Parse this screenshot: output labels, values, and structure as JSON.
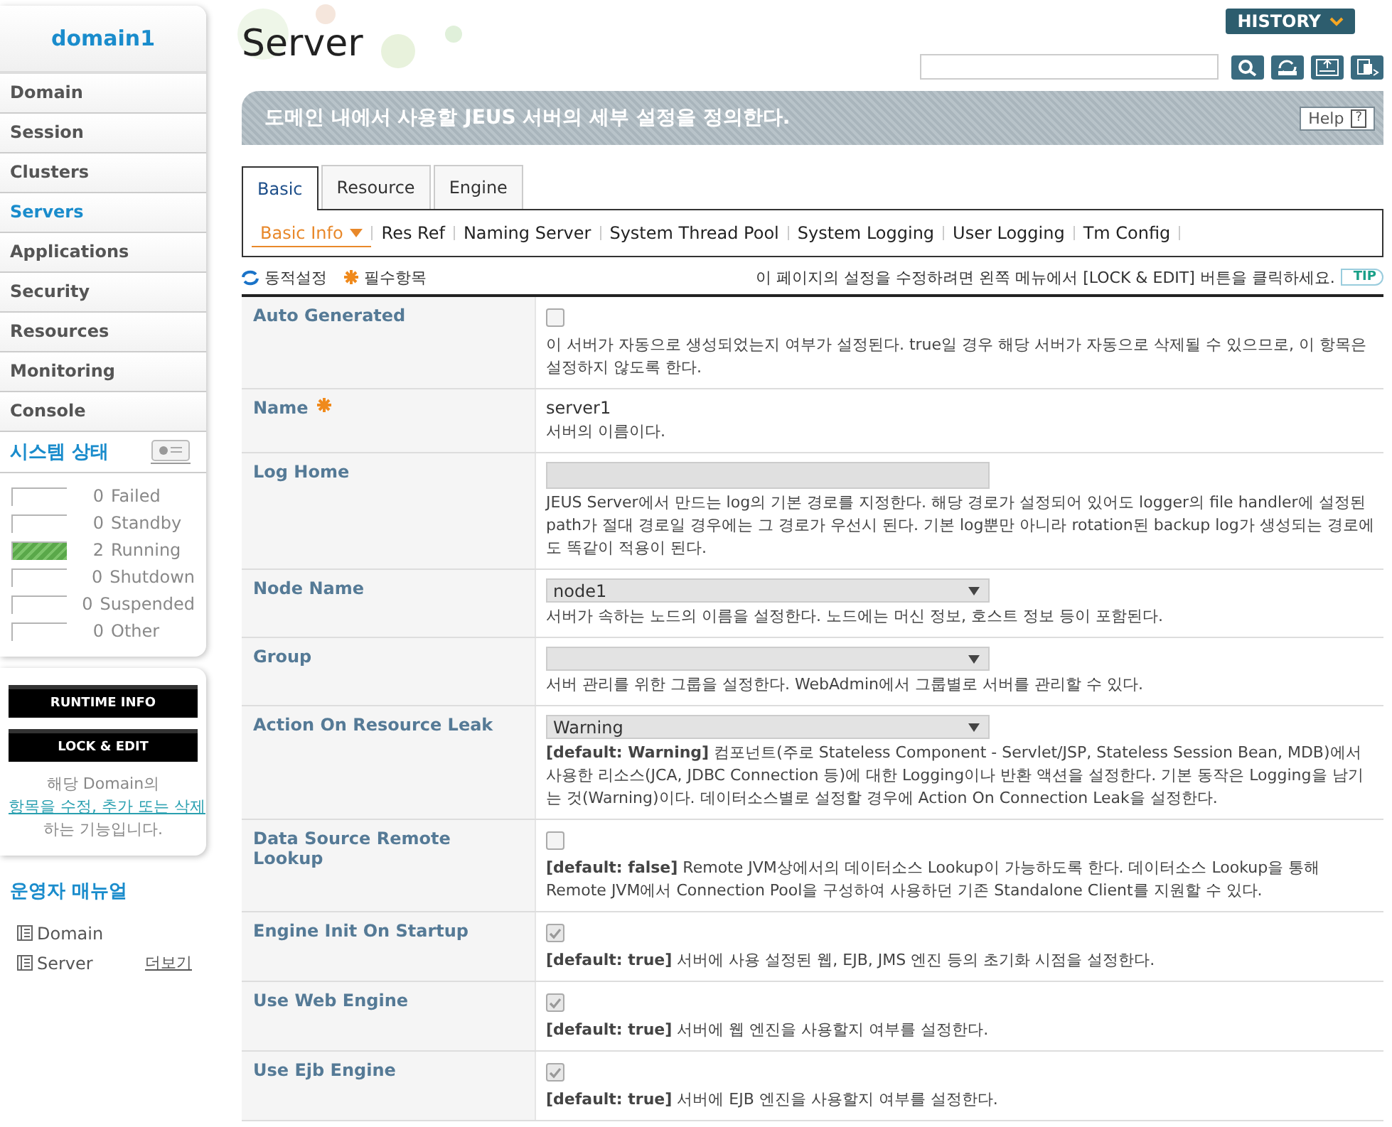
{
  "sidebar": {
    "domain": "domain1",
    "menu": [
      {
        "label": "Domain",
        "selected": false
      },
      {
        "label": "Session",
        "selected": false
      },
      {
        "label": "Clusters",
        "selected": false
      },
      {
        "label": "Servers",
        "selected": true
      },
      {
        "label": "Applications",
        "selected": false
      },
      {
        "label": "Security",
        "selected": false
      },
      {
        "label": "Resources",
        "selected": false
      },
      {
        "label": "Monitoring",
        "selected": false
      },
      {
        "label": "Console",
        "selected": false
      }
    ],
    "status_title": "시스템 상태",
    "status": [
      {
        "count": "0",
        "label": "Failed",
        "level": 0
      },
      {
        "count": "0",
        "label": "Standby",
        "level": 0
      },
      {
        "count": "2",
        "label": "Running",
        "level": 1
      },
      {
        "count": "0",
        "label": "Shutdown",
        "level": 0
      },
      {
        "count": "0",
        "label": "Suspended",
        "level": 0
      },
      {
        "count": "0",
        "label": "Other",
        "level": 0
      }
    ],
    "buttons": [
      "RUNTIME INFO",
      "LOCK & EDIT"
    ],
    "note_before": "해당 Domain의 ",
    "note_link": "항목을 수정, 추가 또는 삭제",
    "note_after": "하는 기능입니다.",
    "manual_title": "운영자 매뉴얼",
    "manual_items": [
      "Domain",
      "Server"
    ],
    "manual_more": "더보기"
  },
  "header": {
    "title": "Server",
    "history": "HISTORY"
  },
  "banner": {
    "text": "도메인 내에서 사용할 JEUS 서버의 세부 설정을 정의한다.",
    "help": "Help",
    "help_icon": "?"
  },
  "tabs": [
    {
      "label": "Basic",
      "selected": true
    },
    {
      "label": "Resource",
      "selected": false
    },
    {
      "label": "Engine",
      "selected": false
    }
  ],
  "subtabs": [
    {
      "label": "Basic Info",
      "selected": true
    },
    {
      "label": "Res Ref",
      "selected": false
    },
    {
      "label": "Naming Server",
      "selected": false
    },
    {
      "label": "System Thread Pool",
      "selected": false
    },
    {
      "label": "System Logging",
      "selected": false
    },
    {
      "label": "User Logging",
      "selected": false
    },
    {
      "label": "Tm Config",
      "selected": false
    }
  ],
  "legend": {
    "dynamic": "동적설정",
    "required": "필수항목",
    "tip_text": "이 페이지의 설정을 수정하려면 왼쪽 메뉴에서 [LOCK & EDIT] 버튼을 클릭하세요.",
    "tip": "TIP"
  },
  "fields": [
    {
      "label": "Auto Generated",
      "required": false,
      "kind": "checkbox",
      "checked": false,
      "description": "이 서버가 자동으로 생성되었는지 여부가 설정된다. true일 경우 해당 서버가 자동으로 삭제될 수 있으므로, 이 항목은 설정하지 않도록 한다."
    },
    {
      "label": "Name",
      "required": true,
      "kind": "text",
      "value": "server1",
      "description": "서버의 이름이다."
    },
    {
      "label": "Log Home",
      "required": false,
      "kind": "input",
      "description": "JEUS Server에서 만드는 log의 기본 경로를 지정한다. 해당 경로가 설정되어 있어도 logger의 file handler에 설정된 path가 절대 경로일 경우에는 그 경로가 우선시 된다. 기본 log뿐만 아니라 rotation된 backup log가 생성되는 경로에도 똑같이 적용이 된다."
    },
    {
      "label": "Node Name",
      "required": false,
      "kind": "select",
      "value": "node1",
      "description": "서버가 속하는 노드의 이름을 설정한다. 노드에는 머신 정보, 호스트 정보 등이 포함된다."
    },
    {
      "label": "Group",
      "required": false,
      "kind": "select",
      "description": "서버 관리를 위한 그룹을 설정한다. WebAdmin에서 그룹별로 서버를 관리할 수 있다."
    },
    {
      "label": "Action On Resource Leak",
      "required": false,
      "kind": "select",
      "value": "Warning",
      "description": "**[default: Warning]**   컴포넌트(주로 Stateless Component - Servlet/JSP, Stateless Session Bean, MDB)에서 사용한 리소스(JCA, JDBC Connection 등)에 대한 Logging이나 반환 액션을 설정한다. 기본 동작은 Logging을 남기는 것(Warning)이다. 데이터소스별로 설정할 경우에 Action On Connection Leak을 설정한다."
    },
    {
      "label": "Data Source Remote Lookup",
      "required": false,
      "kind": "checkbox",
      "checked": false,
      "description": "**[default: false]**   Remote JVM상에서의 데이터소스 Lookup이 가능하도록 한다. 데이터소스 Lookup을 통해 Remote JVM에서 Connection Pool을 구성하여 사용하던 기존 Standalone Client를 지원할 수 있다."
    },
    {
      "label": "Engine Init On Startup",
      "required": false,
      "kind": "checkbox",
      "checked": true,
      "description": "**[default: true]**   서버에 사용 설정된 웹, EJB, JMS 엔진 등의 초기화 시점을 설정한다."
    },
    {
      "label": "Use Web Engine",
      "required": false,
      "kind": "checkbox",
      "checked": true,
      "description": "**[default: true]**   서버에 웹 엔진을 사용할지 여부를 설정한다."
    },
    {
      "label": "Use Ejb Engine",
      "required": false,
      "kind": "checkbox",
      "checked": true,
      "description": "**[default: true]**   서버에 EJB 엔진을 사용할지 여부를 설정한다."
    }
  ]
}
